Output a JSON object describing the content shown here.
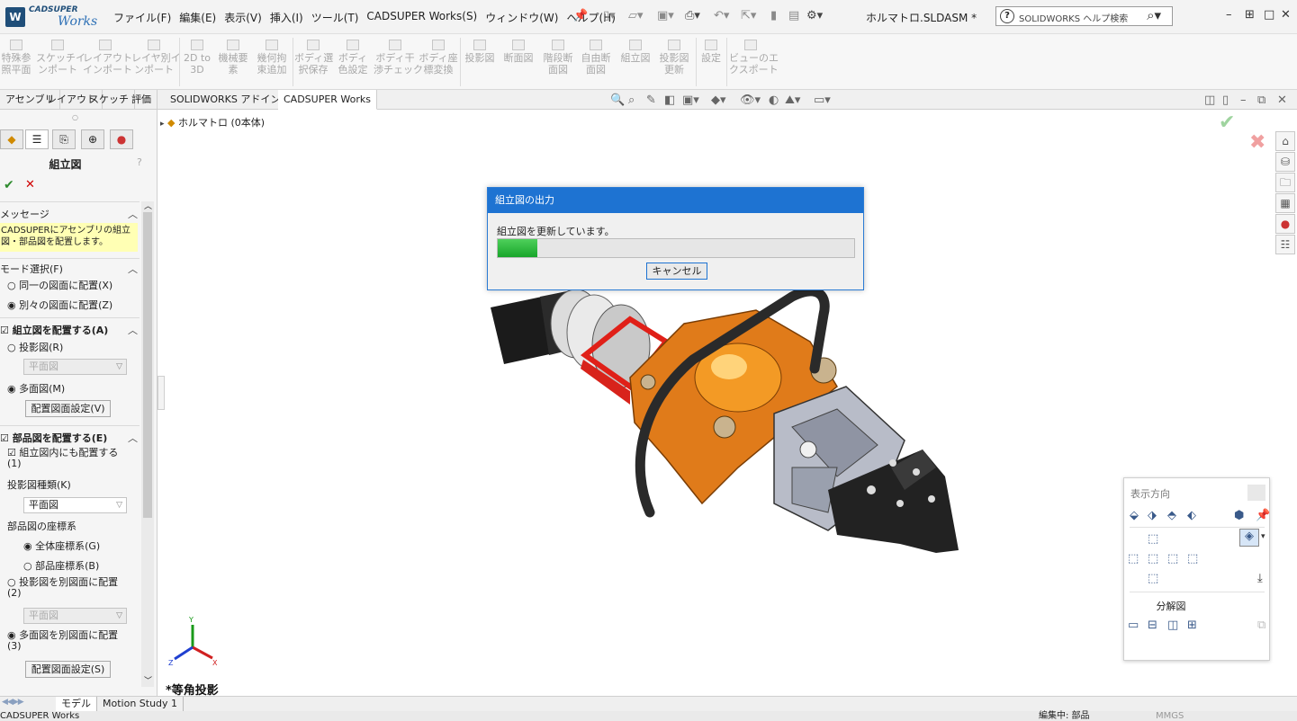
{
  "app": {
    "logo_top": "CADSUPER",
    "logo_bottom": "Works",
    "menus": [
      "ファイル(F)",
      "編集(E)",
      "表示(V)",
      "挿入(I)",
      "ツール(T)",
      "CADSUPER Works(S)",
      "ウィンドウ(W)",
      "ヘルプ(H)"
    ],
    "document_title": "ホルマトロ.SLDASM *",
    "help_search_placeholder": "SOLIDWORKS ヘルプ検索"
  },
  "command_manager": {
    "items": [
      {
        "l1": "特殊参",
        "l2": "照平面"
      },
      {
        "l1": "スケッチイ",
        "l2": "ンポート"
      },
      {
        "l1": "レイアウト",
        "l2": "インポート"
      },
      {
        "l1": "レイヤ別イ",
        "l2": "ンポート"
      },
      {
        "l1": "2D to",
        "l2": "3D"
      },
      {
        "l1": "機械要",
        "l2": "素"
      },
      {
        "l1": "幾何拘",
        "l2": "束追加"
      },
      {
        "l1": "ボディ選",
        "l2": "択保存"
      },
      {
        "l1": "ボディ",
        "l2": "色設定"
      },
      {
        "l1": "ボディ干",
        "l2": "渉チェック"
      },
      {
        "l1": "ボディ座",
        "l2": "標変換"
      },
      {
        "l1": "投影図",
        "l2": ""
      },
      {
        "l1": "断面図",
        "l2": ""
      },
      {
        "l1": "階段断",
        "l2": "面図"
      },
      {
        "l1": "自由断",
        "l2": "面図"
      },
      {
        "l1": "組立図",
        "l2": ""
      },
      {
        "l1": "投影図",
        "l2": "更新"
      },
      {
        "l1": "設定",
        "l2": ""
      },
      {
        "l1": "ビューのエ",
        "l2": "クスポート"
      }
    ]
  },
  "tabs": [
    "アセンブリ",
    "レイアウト",
    "スケッチ",
    "評価",
    "SOLIDWORKS アドイン",
    "CADSUPER Works"
  ],
  "active_tab": "CADSUPER Works",
  "property_manager": {
    "title": "組立図",
    "help": "?",
    "message_header": "メッセージ",
    "message": "CADSUPERにアセンブリの組立図・部品図を配置します。",
    "mode_header": "モード選択(F)",
    "mode_same": "同一の図面に配置(X)",
    "mode_separate": "別々の図面に配置(Z)",
    "assembly_header": "組立図を配置する(A)",
    "projection": "投影図(R)",
    "projection_select": "平面図",
    "multi_view": "多面図(M)",
    "layout_setting_v": "配置図面設定(V)",
    "parts_header": "部品図を配置する(E)",
    "also_in_assembly": "組立図内にも配置する(1)",
    "projection_type_label": "投影図種類(K)",
    "projection_type": "平面図",
    "coord_label": "部品図の座標系",
    "coord_global": "全体座標系(G)",
    "coord_part": "部品座標系(B)",
    "projection_other": "投影図を別図面に配置(2)",
    "projection_other_select": "平面図",
    "multi_other": "多面図を別図面に配置(3)",
    "layout_setting_s": "配置図面設定(S)"
  },
  "tree": {
    "node": "ホルマトロ (0本体)"
  },
  "view_label": "*等角投影",
  "dialog": {
    "title": "組立図の出力",
    "message": "組立図を更新しています。",
    "progress": 0.11,
    "cancel": "キャンセル"
  },
  "view_palette": {
    "title": "表示方向",
    "explode": "分解図"
  },
  "bottom_tabs": [
    "モデル",
    "Motion Study 1"
  ],
  "status": {
    "left": "CADSUPER Works",
    "editing": "編集中: 部品",
    "units": "MMGS"
  },
  "colors": {
    "dialog_title": "#1e73d2",
    "progress": "#1faa32",
    "message_bg": "#ffffb4",
    "accent_orange": "#e07b1a"
  }
}
